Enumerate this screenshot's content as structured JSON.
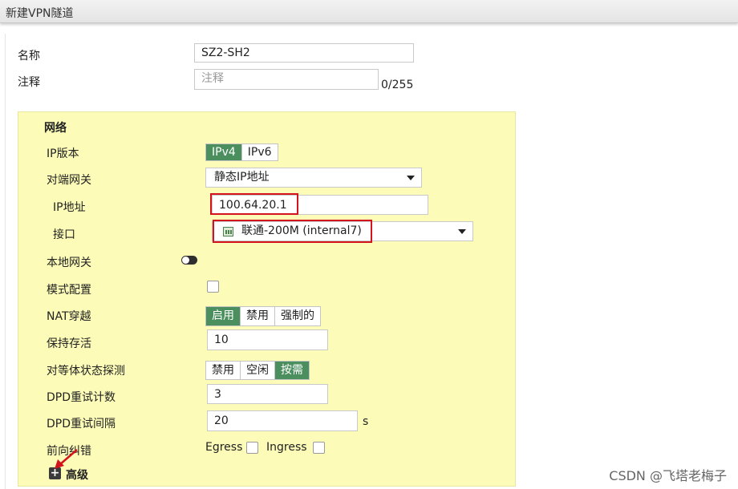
{
  "window": {
    "title": "新建VPN隧道"
  },
  "form": {
    "name_label": "名称",
    "name_value": "SZ2-SH2",
    "comment_label": "注释",
    "comment_placeholder": "注释",
    "comment_counter": "0/255"
  },
  "network": {
    "section_title": "网络",
    "ip_version": {
      "label": "IP版本",
      "options": [
        "IPv4",
        "IPv6"
      ],
      "selected": "IPv4"
    },
    "remote_gateway": {
      "label": "对端网关",
      "value": "静态IP地址"
    },
    "ip_address": {
      "label": "IP地址",
      "value": "100.64.20.1"
    },
    "interface": {
      "label": "接口",
      "value": "联通-200M (internal7)",
      "icon": "network-port-icon"
    },
    "local_gateway": {
      "label": "本地网关",
      "enabled": false
    },
    "mode_config": {
      "label": "模式配置",
      "checked": false
    },
    "nat_traversal": {
      "label": "NAT穿越",
      "options": [
        "启用",
        "禁用",
        "强制的"
      ],
      "selected": "启用"
    },
    "keepalive": {
      "label": "保持存活",
      "value": "10"
    },
    "dpd": {
      "label": "对等体状态探测",
      "options": [
        "禁用",
        "空闲",
        "按需"
      ],
      "selected": "按需"
    },
    "dpd_retry_count": {
      "label": "DPD重试计数",
      "value": "3"
    },
    "dpd_retry_interval": {
      "label": "DPD重试间隔",
      "value": "20",
      "unit": "s"
    },
    "fec": {
      "label": "前向纠错",
      "egress_label": "Egress",
      "ingress_label": "Ingress",
      "egress_checked": false,
      "ingress_checked": false
    },
    "advanced": {
      "label": "高级"
    }
  },
  "watermark": "CSDN @飞塔老梅子",
  "colors": {
    "accent_green": "#4a8f5d",
    "panel_yellow": "#fcfcb8",
    "highlight_red": "#d3141c"
  }
}
